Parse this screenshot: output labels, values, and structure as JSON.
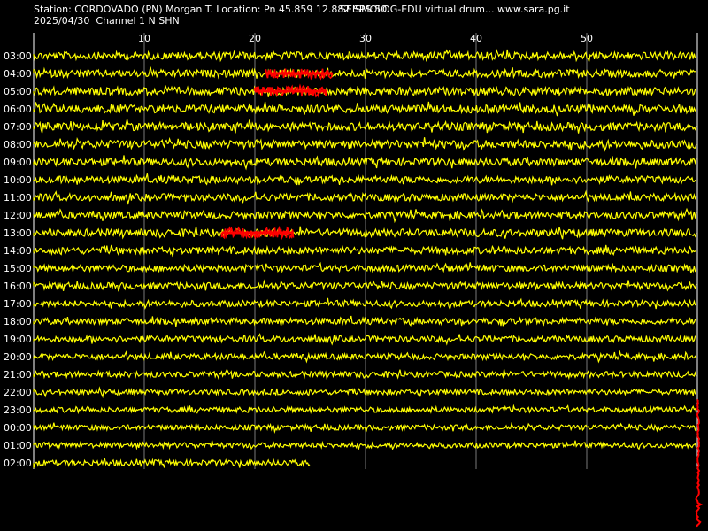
{
  "header": {
    "station": "Station: CORDOVADO (PN) Morgan T. Location: Pn 45.859 12.882 SPS:50",
    "right": "SEISMOLOG-EDU virtual drum... www.sara.pg.it",
    "date_line": "2025/04/30  Channel 1 N SHN"
  },
  "colors": {
    "background": "#000000",
    "trace": "#ffff00",
    "event": "#ff0000",
    "grid": "#ffffff"
  },
  "chart_data": {
    "type": "line",
    "title": "",
    "xlabel": "",
    "ylabel": "",
    "xlim": [
      0,
      60
    ],
    "x_ticks": [
      10,
      20,
      30,
      40,
      50
    ],
    "grid": true,
    "rows": [
      {
        "label": "03:00",
        "amplitude": 0.45
      },
      {
        "label": "04:00",
        "amplitude": 0.45,
        "event": [
          21,
          27
        ]
      },
      {
        "label": "05:00",
        "amplitude": 0.5,
        "event": [
          20,
          26.5
        ]
      },
      {
        "label": "06:00",
        "amplitude": 0.5
      },
      {
        "label": "07:00",
        "amplitude": 0.5
      },
      {
        "label": "08:00",
        "amplitude": 0.5
      },
      {
        "label": "09:00",
        "amplitude": 0.45
      },
      {
        "label": "10:00",
        "amplitude": 0.4
      },
      {
        "label": "11:00",
        "amplitude": 0.4
      },
      {
        "label": "12:00",
        "amplitude": 0.4
      },
      {
        "label": "13:00",
        "amplitude": 0.45,
        "event": [
          17,
          23.5
        ]
      },
      {
        "label": "14:00",
        "amplitude": 0.4
      },
      {
        "label": "15:00",
        "amplitude": 0.35
      },
      {
        "label": "16:00",
        "amplitude": 0.35
      },
      {
        "label": "17:00",
        "amplitude": 0.3
      },
      {
        "label": "18:00",
        "amplitude": 0.3
      },
      {
        "label": "19:00",
        "amplitude": 0.3
      },
      {
        "label": "20:00",
        "amplitude": 0.25
      },
      {
        "label": "21:00",
        "amplitude": 0.25
      },
      {
        "label": "22:00",
        "amplitude": 0.2
      },
      {
        "label": "23:00",
        "amplitude": 0.2
      },
      {
        "label": "00:00",
        "amplitude": 0.2
      },
      {
        "label": "01:00",
        "amplitude": 0.2
      },
      {
        "label": "02:00",
        "amplitude": 0.25,
        "end": 25
      }
    ],
    "current_marker": {
      "x": 60
    }
  }
}
